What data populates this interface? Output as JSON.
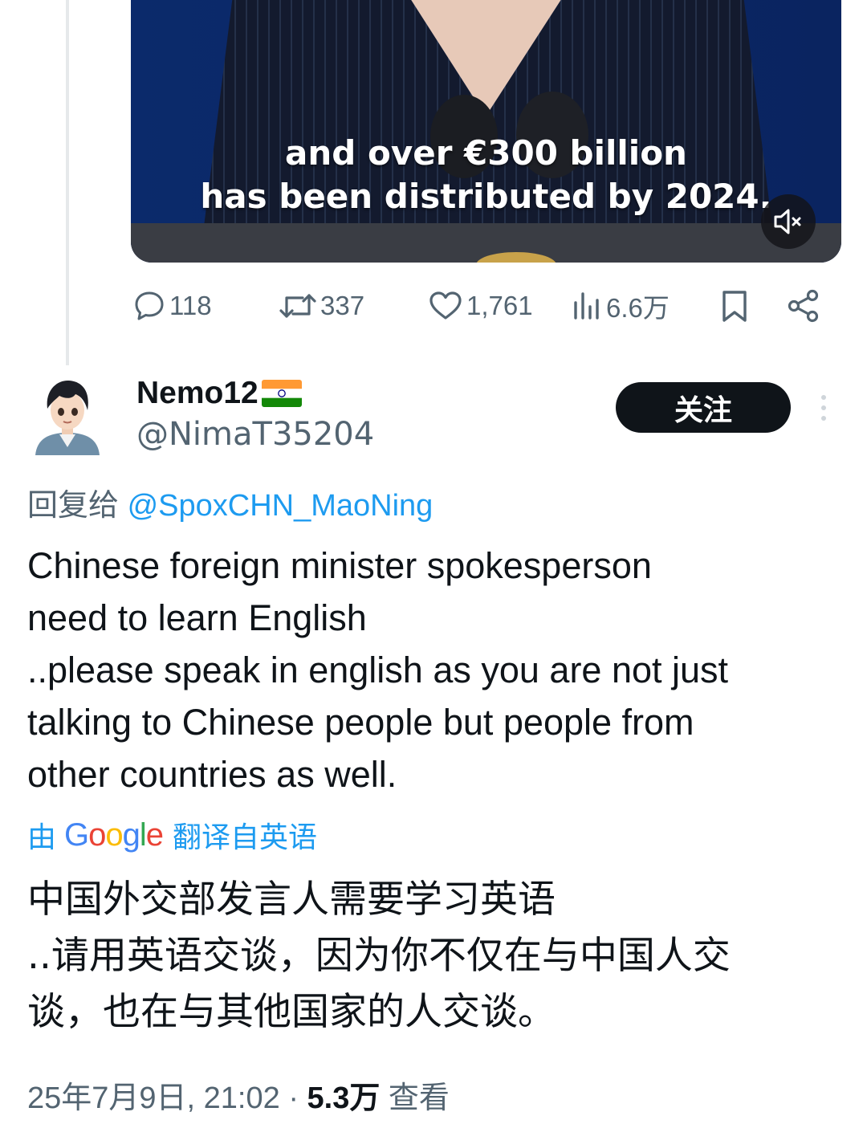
{
  "video": {
    "subtitle_line1": "and over €300 billion",
    "subtitle_line2": "has been distributed by 2024.",
    "mute_icon": "speaker-muted-icon"
  },
  "actions": {
    "replies": "118",
    "retweets": "337",
    "likes": "1,761",
    "views": "6.6万"
  },
  "reply": {
    "display_name": "Nemo12",
    "flag": "india-flag",
    "handle": "@NimaT35204",
    "follow_label": "关注",
    "replying_to_prefix": "回复给",
    "replying_to_handle": "@SpoxCHN_MaoNing",
    "text_lines": [
      "Chinese foreign minister spokesperson",
      "need to learn English",
      "..please speak in english as you are not just",
      "talking to Chinese people but people from",
      "other countries as well."
    ],
    "translate_prefix": "由",
    "translate_brand": "Google",
    "translate_suffix": "翻译自英语",
    "translated_lines": [
      "中国外交部发言人需要学习英语",
      "..请用英语交谈，因为你不仅在与中国人交",
      "谈，也在与其他国家的人交谈。"
    ],
    "timestamp": "25年7月9日, 21:02",
    "separator": "·",
    "views_count": "5.3万",
    "views_label": "查看"
  },
  "colors": {
    "accent": "#1d9bf0",
    "secondary_text": "#536471",
    "primary_text": "#0f1419"
  }
}
